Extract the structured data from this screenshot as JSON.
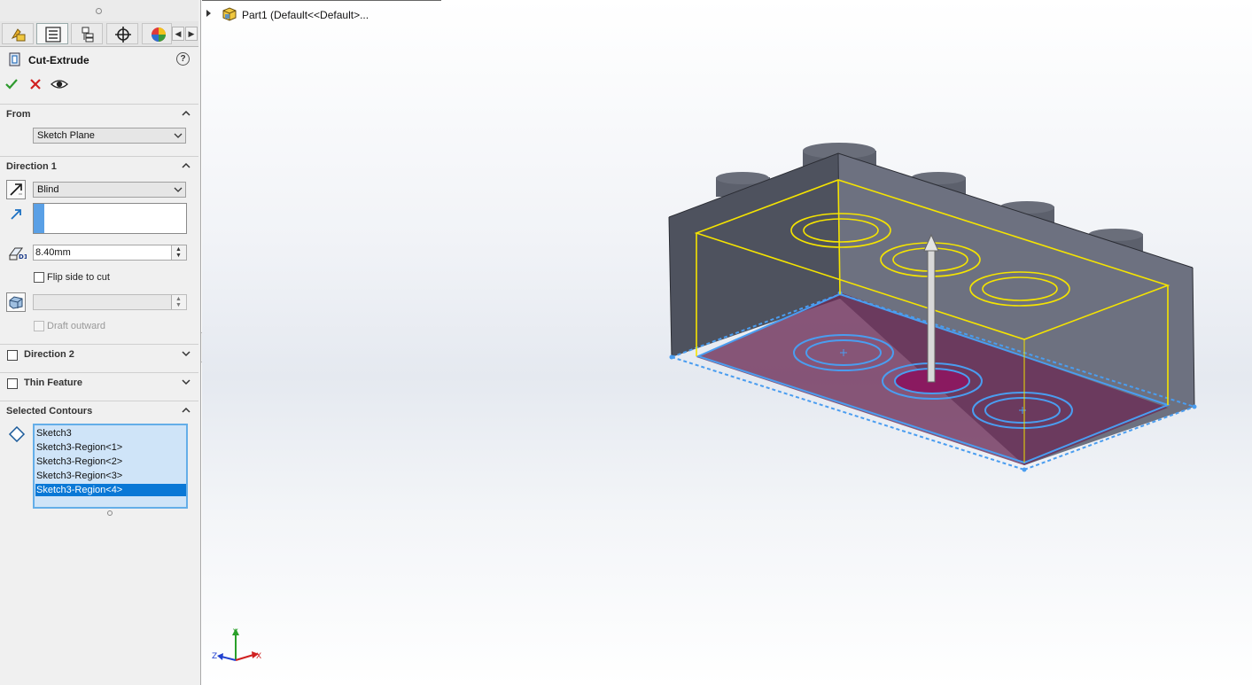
{
  "feature": {
    "title": "Cut-Extrude",
    "help_glyph": "?"
  },
  "sections": {
    "from": {
      "label": "From",
      "start_condition": "Sketch Plane"
    },
    "direction1": {
      "label": "Direction 1",
      "end_condition": "Blind",
      "depth": "8.40mm",
      "flip_side_label": "Flip side to cut",
      "draft_outward_label": "Draft outward"
    },
    "direction2": {
      "label": "Direction 2"
    },
    "thin_feature": {
      "label": "Thin Feature"
    },
    "selected_contours": {
      "label": "Selected Contours",
      "items": [
        "Sketch3",
        "Sketch3-Region<1>",
        "Sketch3-Region<2>",
        "Sketch3-Region<3>",
        "Sketch3-Region<4>"
      ],
      "selected_index": 4
    }
  },
  "tree": {
    "part_label": "Part1  (Default<<Default>..."
  },
  "triad": {
    "x": "X",
    "y": "Y",
    "z": "Z"
  },
  "colors": {
    "accent_blue": "#0a78d6",
    "sketch_yellow": "#f5e400",
    "sketch_blue": "#4a9df0",
    "body_gray": "#5a5e6b",
    "region_purple": "#6a2a55",
    "accept_green": "#2e9a2e",
    "cancel_red": "#d02020"
  }
}
